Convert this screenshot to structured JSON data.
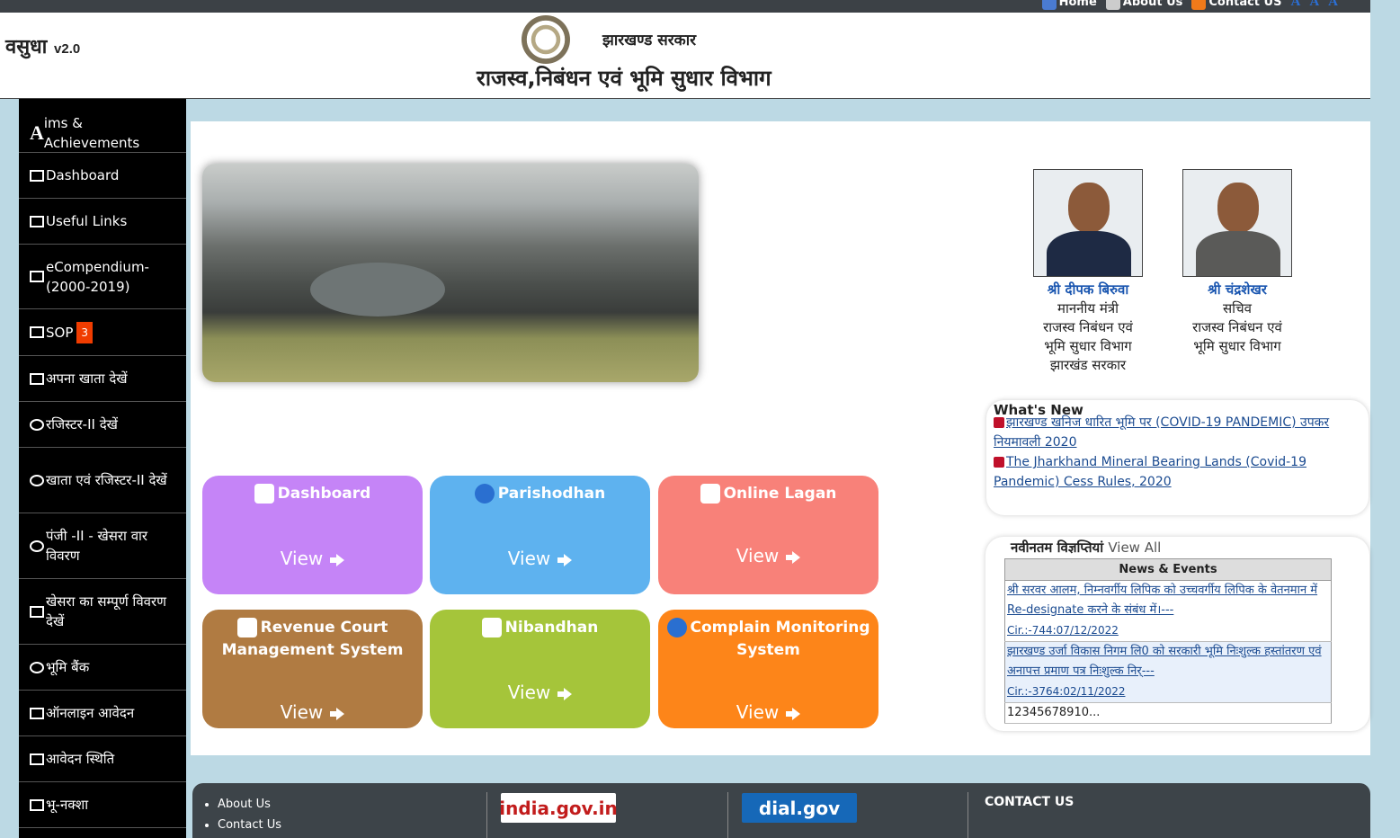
{
  "topnav": {
    "home": "Home",
    "about": "About Us",
    "contact": "Contact US"
  },
  "brand": {
    "name": "वसुधा",
    "version": "v2.0"
  },
  "header": {
    "gov": "झारखण्ड सरकार",
    "dept": "राजस्व,निबंधन एवं भूमि सुधार  विभाग"
  },
  "sidebar": {
    "items": [
      {
        "label": "ims & Achievements",
        "prefix": "A"
      },
      {
        "label": "Dashboard"
      },
      {
        "label": "Useful Links"
      },
      {
        "label": "eCompendium-(2000-2019)"
      },
      {
        "label": "SOP",
        "badge": "3"
      },
      {
        "label": "अपना खाता देखें"
      },
      {
        "label": "रजिस्टर-II देखें"
      },
      {
        "label": "खाता एवं रजिस्टर-II देखें"
      },
      {
        "label": "पंजी -II - खेसरा वार विवरण"
      },
      {
        "label": "खेसरा का सम्पूर्ण विवरण देखें"
      },
      {
        "label": "भूमि बैंक"
      },
      {
        "label": "ऑनलाइन आवेदन"
      },
      {
        "label": "आवेदन स्थिति"
      },
      {
        "label": "भू-नक्शा"
      }
    ]
  },
  "tiles": [
    {
      "title": "Dashboard",
      "view": "View",
      "color": "#c584f7"
    },
    {
      "title": "Parishodhan",
      "view": "View",
      "color": "#5eb2ef"
    },
    {
      "title": "Online Lagan",
      "view": "View",
      "color": "#f88179"
    },
    {
      "title": "Revenue Court Management System",
      "view": "View",
      "color": "#b07b42"
    },
    {
      "title": "Nibandhan",
      "view": "View",
      "color": "#a5c53a"
    },
    {
      "title": "Complain Monitoring System",
      "view": "View",
      "color": "#fd8519"
    }
  ],
  "officials": [
    {
      "name": "श्री दीपक बिरुवा",
      "l1": "माननीय मंत्री",
      "l2": "राजस्व निबंधन एवं",
      "l3": "भूमि सुधार विभाग",
      "l4": "झारखंड सरकार"
    },
    {
      "name": "श्री चंद्रशेखर",
      "l1": "सचिव",
      "l2": "राजस्व निबंधन एवं",
      "l3": "भूमि सुधार विभाग"
    }
  ],
  "whats_new": {
    "title": "What's New",
    "items": [
      "झारखण्ड खनिज धारित भूमि पर (COVID-19 PANDEMIC) उपकर नियमावली 2020",
      "The Jharkhand Mineral Bearing Lands (Covid-19 Pandemic) Cess Rules, 2020"
    ]
  },
  "notifications": {
    "title": "नवीनतम विज्ञप्तियां",
    "view_all": "View All",
    "header": "News & Events",
    "rows": [
      {
        "text": "श्री सरवर आलम, निम्नवर्गीय लिपिक को उच्चवर्गीय लिपिक के वेतनमान में Re-designate करने के संबंध में।---",
        "ref": "Cir.:-744:07/12/2022"
      },
      {
        "text": "झारखण्ड उर्जा विकास निगम लि0 को सरकारी भूमि निःशुल्क हस्तांतरण एवं अनापत्त प्रमाण पत्र निःशुल्क निर्---",
        "ref": "Cir.:-3764:02/11/2022"
      }
    ],
    "pager": "12345678910..."
  },
  "footer": {
    "links": [
      "About Us",
      "Contact Us"
    ],
    "logo1": "india.gov.in",
    "logo2": "dial.gov",
    "contact": "CONTACT US"
  }
}
